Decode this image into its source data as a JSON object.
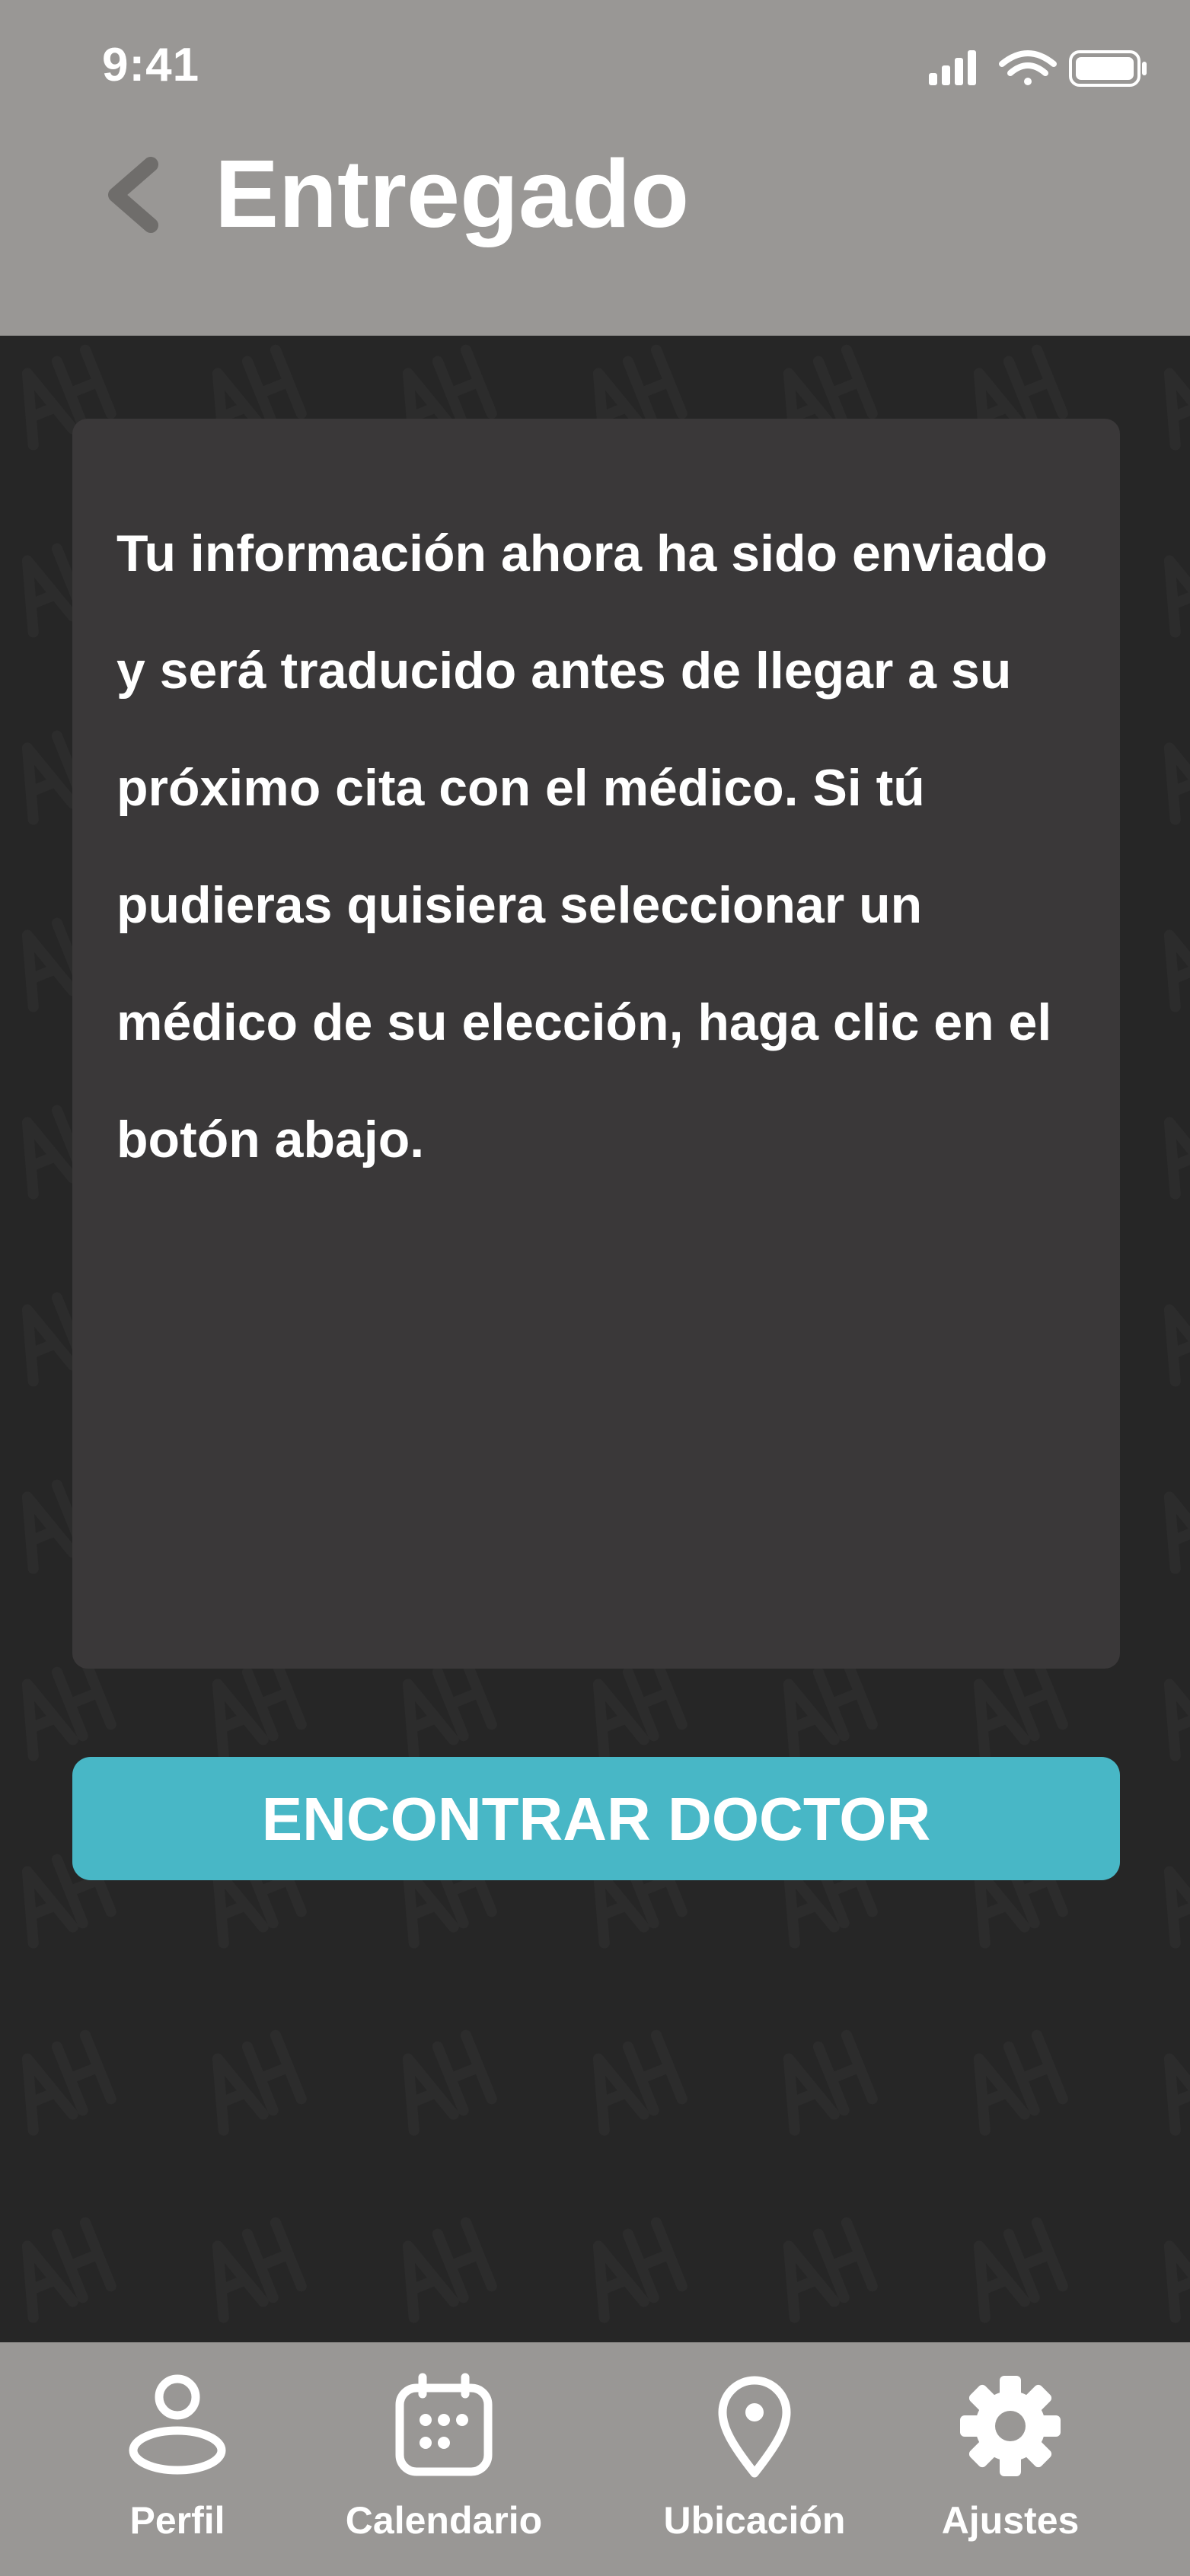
{
  "status_bar": {
    "time": "9:41",
    "icons": [
      "signal-icon",
      "wifi-icon",
      "battery-icon"
    ]
  },
  "header": {
    "back_icon": "chevron-left-icon",
    "title": "Entregado"
  },
  "background": {
    "watermark": "AH"
  },
  "message": {
    "text": "Tu información ahora ha sido enviado y será traducido antes de llegar a su próximo cita con el médico. Si tú pudieras quisiera seleccionar un médico de su elección, haga clic en el botón abajo."
  },
  "actions": {
    "find_doctor_label": "ENCONTRAR DOCTOR"
  },
  "bottom_nav": {
    "items": [
      {
        "label": "Perfil",
        "icon": "profile-icon"
      },
      {
        "label": "Calendario",
        "icon": "calendar-icon"
      },
      {
        "label": "Ubicación",
        "icon": "location-pin-icon"
      },
      {
        "label": "Ajustes",
        "icon": "gear-icon"
      }
    ]
  },
  "colors": {
    "header_bg": "#999795",
    "page_bg": "#262626",
    "card_bg": "#3a3839",
    "accent": "#48b7c6",
    "text": "#ffffff"
  }
}
